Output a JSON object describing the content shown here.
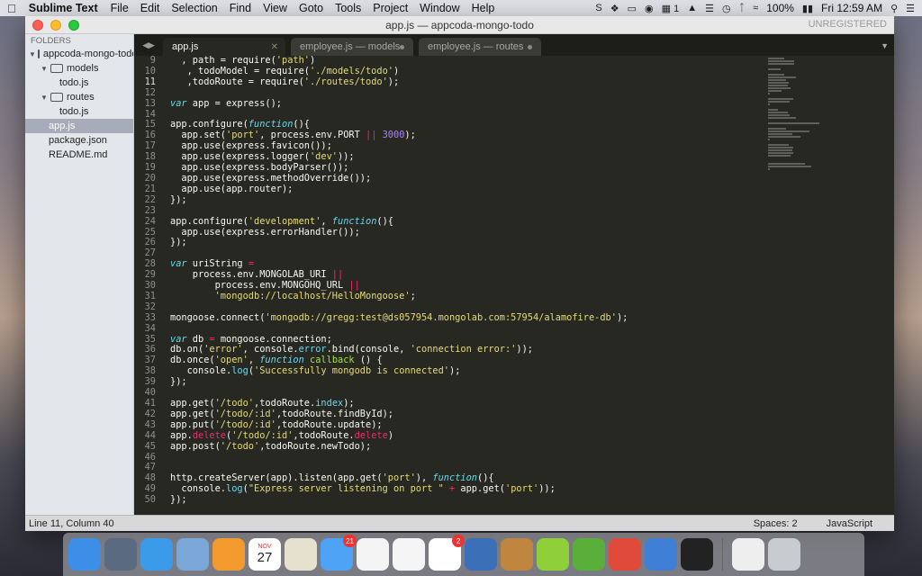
{
  "menubar": {
    "app_name": "Sublime Text",
    "menus": [
      "File",
      "Edit",
      "Selection",
      "Find",
      "View",
      "Goto",
      "Tools",
      "Project",
      "Window",
      "Help"
    ],
    "status": {
      "notification_count": "1",
      "battery": "100%",
      "clock": "Fri 12:59 AM"
    }
  },
  "window": {
    "title": "app.js — appcoda-mongo-todo",
    "unregistered": "UNREGISTERED"
  },
  "sidebar": {
    "header": "FOLDERS",
    "items": [
      {
        "label": "appcoda-mongo-todo",
        "type": "folder",
        "depth": 0
      },
      {
        "label": "models",
        "type": "folder",
        "depth": 1
      },
      {
        "label": "todo.js",
        "type": "file",
        "depth": 2
      },
      {
        "label": "routes",
        "type": "folder",
        "depth": 1
      },
      {
        "label": "todo.js",
        "type": "file",
        "depth": 2
      },
      {
        "label": "app.js",
        "type": "file",
        "depth": 1,
        "selected": true
      },
      {
        "label": "package.json",
        "type": "file",
        "depth": 1
      },
      {
        "label": "README.md",
        "type": "file",
        "depth": 1
      }
    ]
  },
  "tabs": [
    {
      "label": "app.js",
      "active": true
    },
    {
      "label": "employee.js — models",
      "active": false
    },
    {
      "label": "employee.js — routes",
      "active": false
    }
  ],
  "editor": {
    "lines": [
      {
        "n": "9",
        "html": "  , path = require(<span class='str'>'path'</span>)"
      },
      {
        "n": "10",
        "html": "   , todoModel = require(<span class='str'>'./models/todo'</span>)"
      },
      {
        "n": "11",
        "html": "   ,todoRoute = require(<span class='str'>'./routes/todo'</span>);",
        "current": true
      },
      {
        "n": "12",
        "html": ""
      },
      {
        "n": "13",
        "html": "<span class='kw'>var</span> app = express();"
      },
      {
        "n": "14",
        "html": ""
      },
      {
        "n": "15",
        "html": "app.configure(<span class='kw'>function</span>(){"
      },
      {
        "n": "16",
        "html": "  app.set(<span class='str'>'port'</span>, process.env.PORT <span class='op'>||</span> <span class='num'>3000</span>);"
      },
      {
        "n": "17",
        "html": "  app.use(express.favicon());"
      },
      {
        "n": "18",
        "html": "  app.use(express.logger(<span class='str'>'dev'</span>));"
      },
      {
        "n": "19",
        "html": "  app.use(express.bodyParser());"
      },
      {
        "n": "20",
        "html": "  app.use(express.methodOverride());"
      },
      {
        "n": "21",
        "html": "  app.use(app.router);"
      },
      {
        "n": "22",
        "html": "});"
      },
      {
        "n": "23",
        "html": ""
      },
      {
        "n": "24",
        "html": "app.configure(<span class='str'>'development'</span>, <span class='kw'>function</span>(){"
      },
      {
        "n": "25",
        "html": "  app.use(express.errorHandler());"
      },
      {
        "n": "26",
        "html": "});"
      },
      {
        "n": "27",
        "html": ""
      },
      {
        "n": "28",
        "html": "<span class='kw'>var</span> uriString <span class='op'>=</span>"
      },
      {
        "n": "29",
        "html": "    process.env.MONGOLAB_URI <span class='op'>||</span>"
      },
      {
        "n": "30",
        "html": "        process.env.MONGOHQ_URL <span class='op'>||</span>"
      },
      {
        "n": "31",
        "html": "        <span class='str'>'mongodb://localhost/HelloMongoose'</span>;"
      },
      {
        "n": "32",
        "html": ""
      },
      {
        "n": "33",
        "html": "mongoose.connect(<span class='str'>'mongodb://gregg:test@ds057954.mongolab.com:57954/alamofire-db'</span>);"
      },
      {
        "n": "34",
        "html": ""
      },
      {
        "n": "35",
        "html": "<span class='kw'>var</span> db <span class='op'>=</span> mongoose.connection;"
      },
      {
        "n": "36",
        "html": "db.on(<span class='str'>'error'</span>, console.<span class='prop'>error</span>.bind(console, <span class='str'>'connection error:'</span>));"
      },
      {
        "n": "37",
        "html": "db.once(<span class='str'>'open'</span>, <span class='kw'>function</span> <span class='fn'>callback</span> () {"
      },
      {
        "n": "38",
        "html": "   console.<span class='prop'>log</span>(<span class='str'>'Successfully mongodb is connected'</span>);"
      },
      {
        "n": "39",
        "html": "});"
      },
      {
        "n": "40",
        "html": ""
      },
      {
        "n": "41",
        "html": "app.get(<span class='str'>'/todo'</span>,todoRoute.<span class='prop'>index</span>);"
      },
      {
        "n": "42",
        "html": "app.get(<span class='str'>'/todo/:id'</span>,todoRoute.findById);"
      },
      {
        "n": "43",
        "html": "app.put(<span class='str'>'/todo/:id'</span>,todoRoute.update);"
      },
      {
        "n": "44",
        "html": "app.<span class='del'>delete</span>(<span class='str'>'/todo/:id'</span>,todoRoute.<span class='del'>delete</span>)"
      },
      {
        "n": "45",
        "html": "app.post(<span class='str'>'/todo'</span>,todoRoute.newTodo);"
      },
      {
        "n": "46",
        "html": ""
      },
      {
        "n": "47",
        "html": ""
      },
      {
        "n": "48",
        "html": "http.createServer(app).listen(app.get(<span class='str'>'port'</span>), <span class='kw'>function</span>(){"
      },
      {
        "n": "49",
        "html": "  console.<span class='prop'>log</span>(<span class='str'>\"Express server listening on port \"</span> <span class='op'>+</span> app.get(<span class='str'>'port'</span>));"
      },
      {
        "n": "50",
        "html": "});"
      }
    ]
  },
  "statusbar": {
    "position": "Line 11, Column 40",
    "indentation": "Spaces: 2",
    "syntax": "JavaScript"
  },
  "dock": {
    "apps": [
      {
        "name": "finder",
        "color": "#3d8ee6"
      },
      {
        "name": "launchpad",
        "color": "#5a6a80"
      },
      {
        "name": "safari",
        "color": "#3c9be8"
      },
      {
        "name": "mail",
        "color": "#7aa7d8"
      },
      {
        "name": "pages",
        "color": "#f29a2e"
      },
      {
        "name": "calendar",
        "color": "#ffffff",
        "text": "27",
        "month": "NOV"
      },
      {
        "name": "textedit",
        "color": "#e6e0cf"
      },
      {
        "name": "messages",
        "color": "#4fa3f7",
        "badge": "21"
      },
      {
        "name": "photos",
        "color": "#f4f4f4"
      },
      {
        "name": "itunes",
        "color": "#f5f5f5"
      },
      {
        "name": "slack",
        "color": "#ffffff",
        "badge": "2"
      },
      {
        "name": "xcode",
        "color": "#3b6fb8"
      },
      {
        "name": "preview",
        "color": "#c08640"
      },
      {
        "name": "lime-app",
        "color": "#8fcf3a"
      },
      {
        "name": "leaf-app",
        "color": "#5aae3a"
      },
      {
        "name": "chrome",
        "color": "#e04a3a"
      },
      {
        "name": "simulator",
        "color": "#3f7fd6"
      },
      {
        "name": "terminal",
        "color": "#222222"
      },
      {
        "name": "documents",
        "color": "#eeeeee"
      },
      {
        "name": "trash",
        "color": "#c8ccd0"
      }
    ]
  }
}
